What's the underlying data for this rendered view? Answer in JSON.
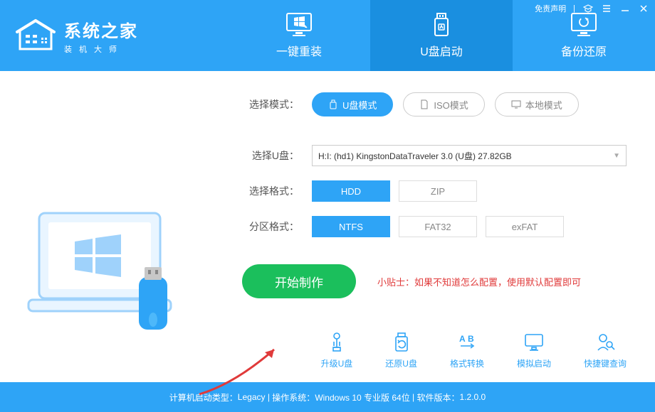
{
  "header": {
    "logo_main": "系统之家",
    "logo_sub": "装机大师",
    "disclaimer": "免责声明",
    "tabs": [
      {
        "label": "一键重装"
      },
      {
        "label": "U盘启动"
      },
      {
        "label": "备份还原"
      }
    ]
  },
  "modes": {
    "label": "选择模式：",
    "usb": "U盘模式",
    "iso": "ISO模式",
    "local": "本地模式"
  },
  "usb_select": {
    "label": "选择U盘：",
    "value": "H:I: (hd1) KingstonDataTraveler 3.0 (U盘) 27.82GB"
  },
  "format": {
    "label": "选择格式：",
    "options": [
      "HDD",
      "ZIP"
    ]
  },
  "partition": {
    "label": "分区格式：",
    "options": [
      "NTFS",
      "FAT32",
      "exFAT"
    ]
  },
  "action": {
    "start": "开始制作",
    "tip": "小贴士：如果不知道怎么配置，使用默认配置即可"
  },
  "tools": [
    {
      "label": "升级U盘"
    },
    {
      "label": "还原U盘"
    },
    {
      "label": "格式转换"
    },
    {
      "label": "模拟启动"
    },
    {
      "label": "快捷键查询"
    }
  ],
  "statusbar": {
    "boot_type_label": "计算机启动类型：",
    "boot_type": "Legacy",
    "os_label": "操作系统：",
    "os": "Windows 10 专业版 64位",
    "version_label": "软件版本：",
    "version": "1.2.0.0"
  }
}
